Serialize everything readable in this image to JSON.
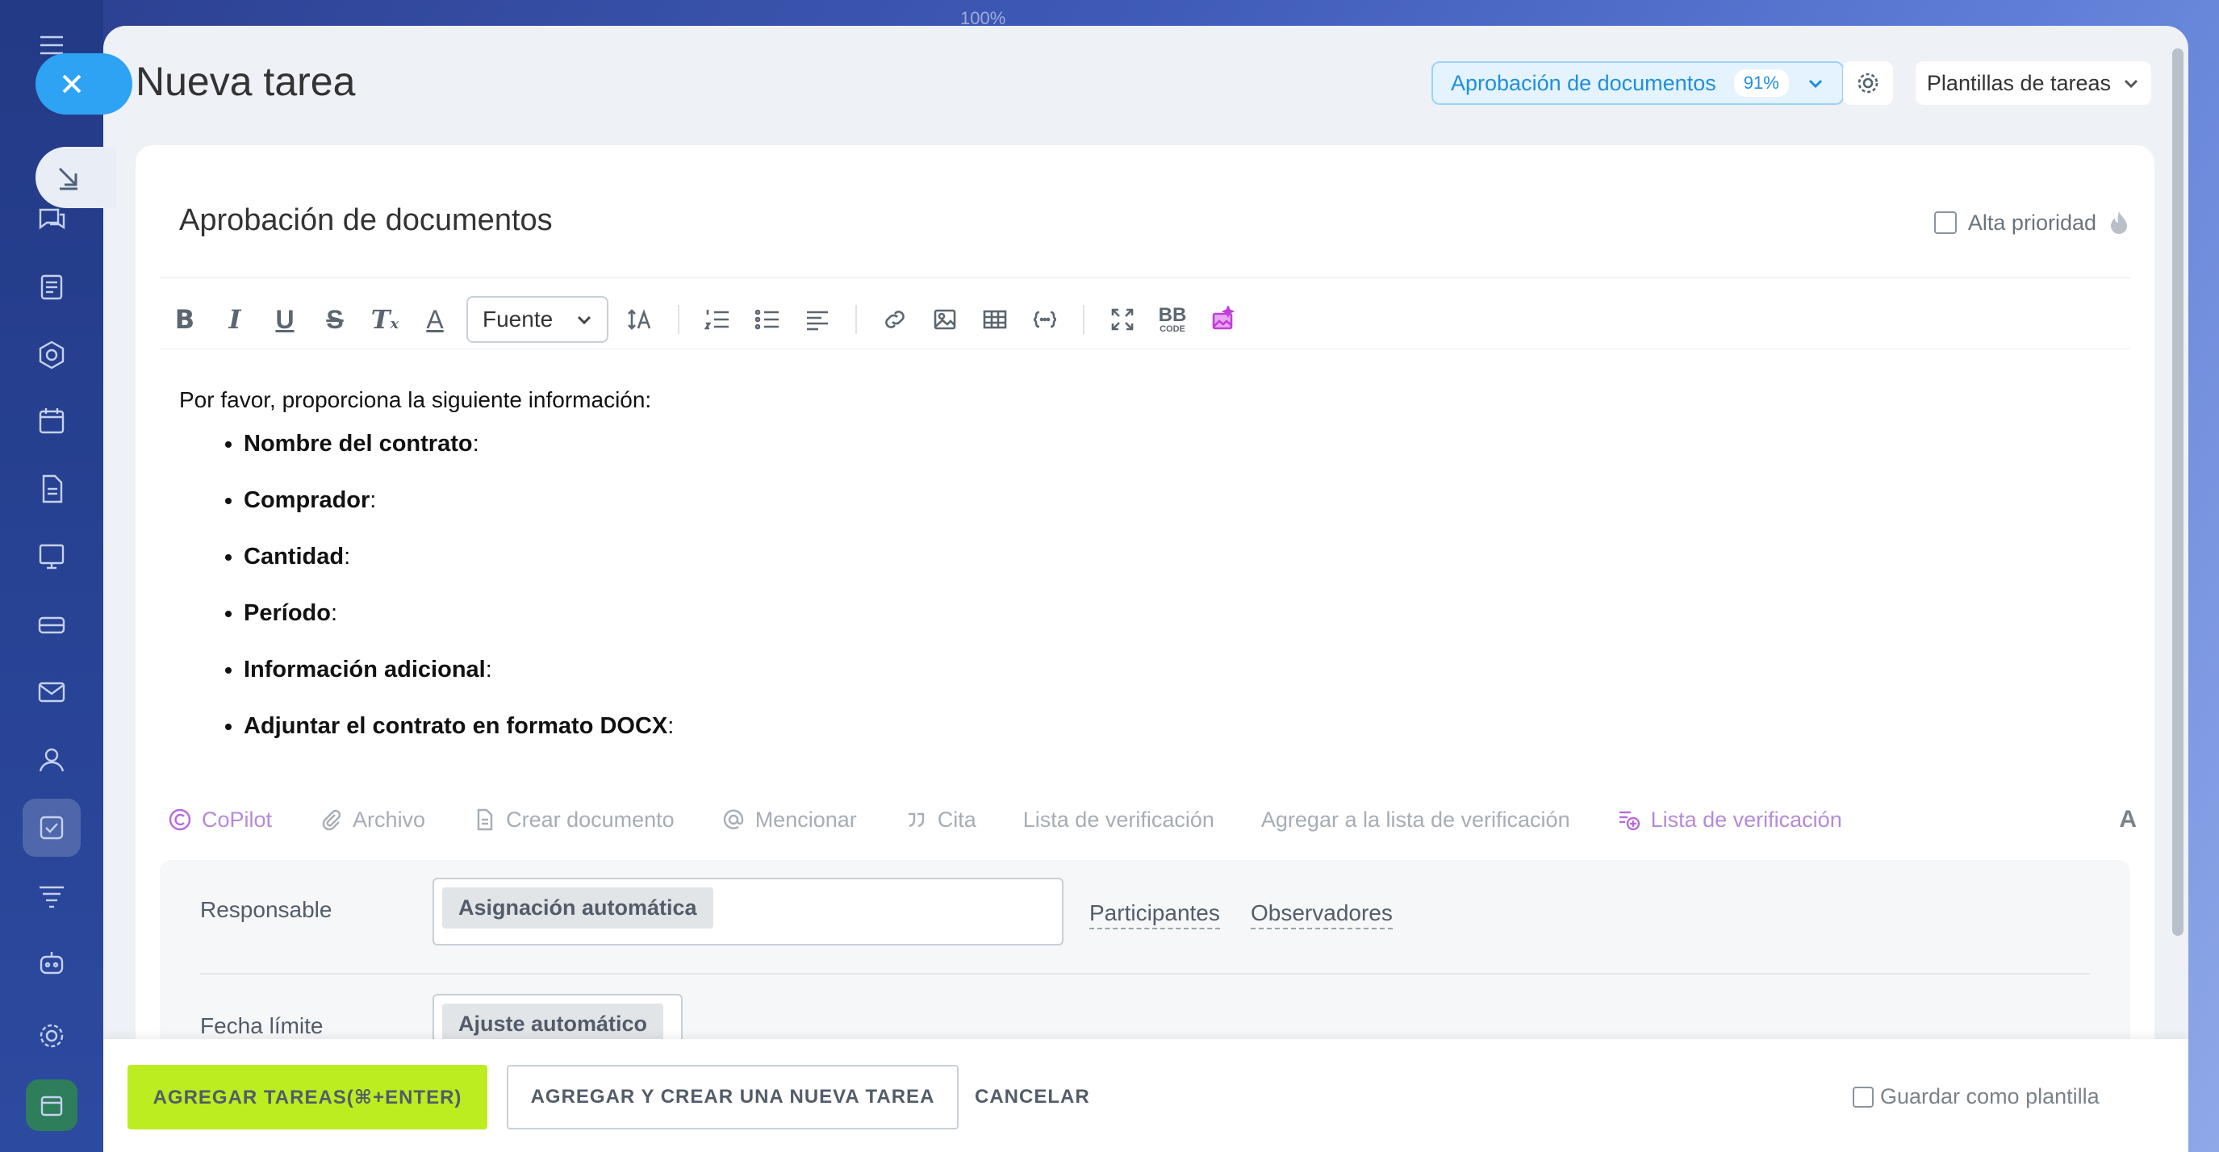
{
  "window": {
    "zoom": "100%"
  },
  "header": {
    "title": "Nueva tarea",
    "template_flow": {
      "label": "Aprobación de documentos",
      "percent": "91%"
    },
    "templates_button": "Plantillas de tareas"
  },
  "task": {
    "title": "Aprobación de documentos",
    "high_priority_label": "Alta prioridad"
  },
  "toolbar": {
    "font_select": "Fuente",
    "bbcode": "BB",
    "bbcode_sub": "CODE"
  },
  "editor": {
    "intro": "Por favor, proporciona la siguiente información:",
    "items": [
      {
        "label": "Nombre del contrato",
        "suffix": ":"
      },
      {
        "label": "Comprador",
        "suffix": ":"
      },
      {
        "label": "Cantidad",
        "suffix": ":"
      },
      {
        "label": "Período",
        "suffix": ":"
      },
      {
        "label": "Información adicional",
        "suffix": ":"
      },
      {
        "label": "Adjuntar el contrato en formato DOCX",
        "suffix": ":"
      }
    ]
  },
  "actions": {
    "copilot": "CoPilot",
    "file": "Archivo",
    "create_document": "Crear documento",
    "mention": "Mencionar",
    "quote": "Cita",
    "checklist": "Lista de verificación",
    "add_to_checklist": "Agregar a la lista de verificación",
    "checklist_new": "Lista de verificación",
    "format": "A"
  },
  "fields": {
    "responsible": {
      "label": "Responsable",
      "value": "Asignación automática"
    },
    "participants": "Participantes",
    "observers": "Observadores",
    "deadline": {
      "label": "Fecha límite",
      "value": "Ajuste automático"
    }
  },
  "footer": {
    "add_task": "AGREGAR TAREAS(⌘+ENTER)",
    "add_and_create": "AGREGAR Y CREAR UNA NUEVA TAREA",
    "cancel": "CANCELAR",
    "save_as_template": "Guardar como plantilla"
  },
  "colors": {
    "accent": "#2fa3f3",
    "primary_button": "#bbed21",
    "copilot": "#b66bdc"
  }
}
